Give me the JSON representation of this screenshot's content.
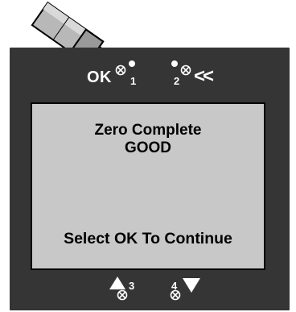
{
  "screen": {
    "line1": "Zero Complete",
    "line2": "GOOD",
    "line3": "Select OK To Continue"
  },
  "buttons": {
    "ok_label": "OK",
    "button1_number": "1",
    "button2_number": "2",
    "back_label": "<<",
    "button3_number": "3",
    "button4_number": "4",
    "up_icon": "triangle-up-icon",
    "down_icon": "triangle-down-icon"
  },
  "colors": {
    "panel": "#353535",
    "lcd": "#c8c8c8",
    "text": "#000000",
    "button_text": "#ffffff"
  }
}
